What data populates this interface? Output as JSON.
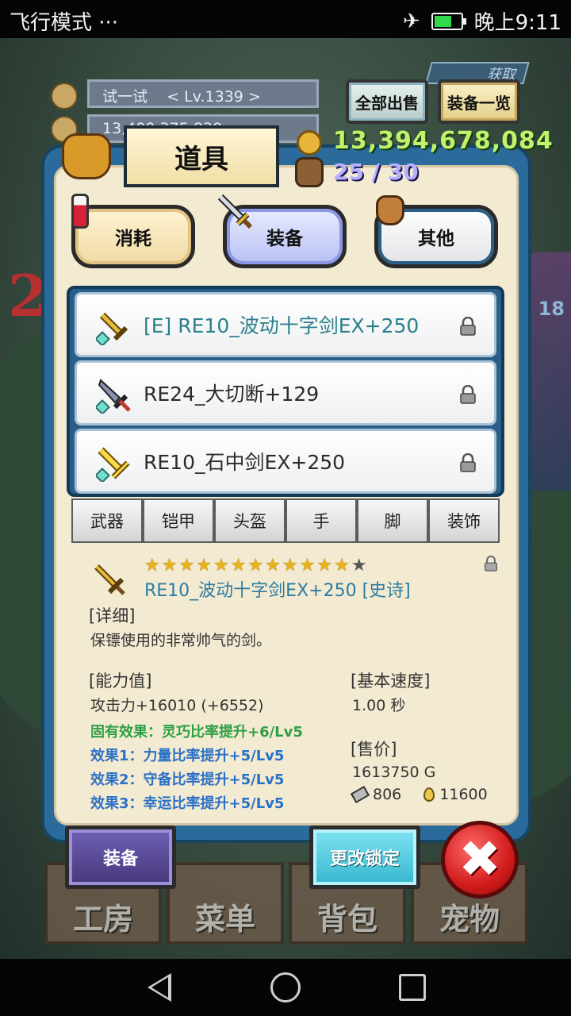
{
  "status_bar": {
    "left_text": "飞行模式 ···",
    "time": "晚上9:11"
  },
  "hud": {
    "player_name": "试一试",
    "player_level": "< Lv.1339 >",
    "currency_partial": "13,400,375,830",
    "sell_all_label": "全部出售",
    "equip_list_label": "装备一览",
    "obtain_label": "获取"
  },
  "panel": {
    "title": "道具",
    "gold": "13,394,678,084",
    "slots": "25 / 30"
  },
  "categories": [
    {
      "label": "消耗"
    },
    {
      "label": "装备"
    },
    {
      "label": "其他"
    }
  ],
  "items": [
    {
      "label": "[E] RE10_波动十字剑EX+250"
    },
    {
      "label": "RE24_大切断+129"
    },
    {
      "label": "RE10_石中剑EX+250"
    }
  ],
  "subtabs": [
    {
      "label": "武器"
    },
    {
      "label": "铠甲"
    },
    {
      "label": "头盔"
    },
    {
      "label": "手"
    },
    {
      "label": "脚"
    },
    {
      "label": "装饰"
    }
  ],
  "detail": {
    "stars_filled": 12,
    "stars_total": 13,
    "title": "RE10_波动十字剑EX+250 [史诗]",
    "detail_heading": "[详细]",
    "description": "保镖使用的非常帅气的剑。",
    "stats_heading": "[能力值]",
    "attack": "攻击力+16010 (+6552)",
    "inherent": "固有效果：灵巧比率提升+6/Lv5",
    "effect1": "效果1：力量比率提升+5/Lv5",
    "effect2": "效果2：守备比率提升+5/Lv5",
    "effect3": "效果3：幸运比率提升+5/Lv5",
    "speed_heading": "[基本速度]",
    "speed": "1.00 秒",
    "price_heading": "[售价]",
    "price": "1613750 G",
    "stone": "806",
    "drop": "11600"
  },
  "buttons": {
    "equip": "装备",
    "change_lock": "更改锁定",
    "close": "✖"
  },
  "menu": [
    "工房",
    "菜单",
    "背包",
    "宠物"
  ],
  "colors": {
    "panel_border": "#2a6b9b",
    "panel_bg": "#f3ead2",
    "gold_text": "#bff36a",
    "equipped_text": "#2b7f8c",
    "effect_green": "#2fa043",
    "effect_blue": "#2b71c7"
  }
}
